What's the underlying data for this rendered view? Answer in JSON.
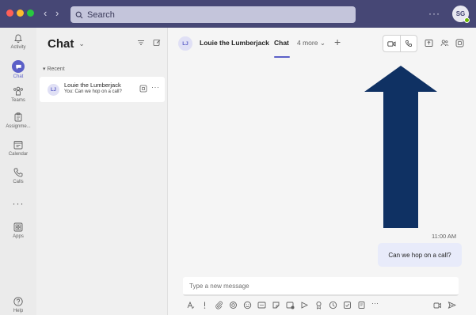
{
  "titlebar": {
    "back_label": "‹",
    "forward_label": "›",
    "search_placeholder": "Search",
    "more_label": "···",
    "user_initials": "SG"
  },
  "rail": {
    "items": [
      {
        "label": "Activity",
        "icon": "bell-icon"
      },
      {
        "label": "Chat",
        "icon": "chat-icon"
      },
      {
        "label": "Teams",
        "icon": "teams-icon"
      },
      {
        "label": "Assignme...",
        "icon": "assignments-icon"
      },
      {
        "label": "Calendar",
        "icon": "calendar-icon"
      },
      {
        "label": "Calls",
        "icon": "phone-icon"
      },
      {
        "label": "···",
        "icon": "more-icon"
      },
      {
        "label": "Apps",
        "icon": "apps-icon"
      },
      {
        "label": "Help",
        "icon": "help-icon"
      }
    ]
  },
  "chat_list": {
    "title": "Chat",
    "section_label": "Recent",
    "conversations": [
      {
        "initials": "LJ",
        "name": "Louie the Lumberjack",
        "preview": "You: Can we hop on a call?"
      }
    ]
  },
  "main": {
    "header": {
      "initials": "LJ",
      "name": "Louie the Lumberjack",
      "active_tab": "Chat",
      "more_tabs": "4 more",
      "add_tab": "+"
    },
    "messages": [
      {
        "time": "11:00 AM",
        "text": "Can we hop on a call?",
        "from_me": true
      }
    ],
    "composer": {
      "placeholder": "Type a new message"
    }
  },
  "colors": {
    "titlebar": "#464775",
    "accent": "#5b5fc7",
    "arrow": "#0f3163",
    "bubble": "#e8ebfa"
  }
}
